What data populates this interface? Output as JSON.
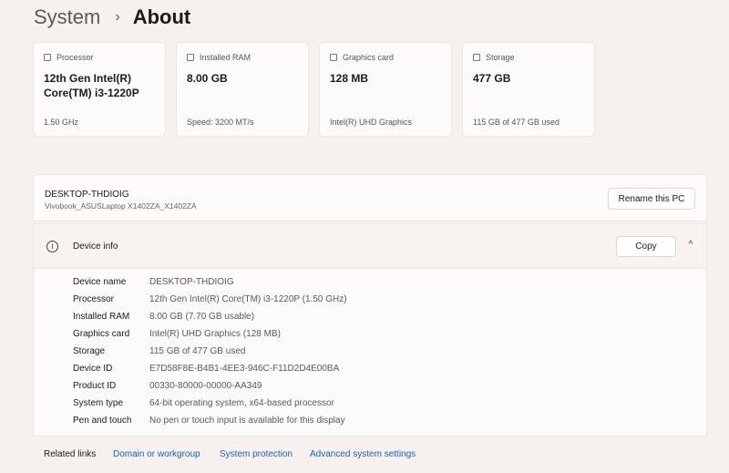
{
  "breadcrumb": {
    "parent": "System",
    "separator": "›",
    "current": "About"
  },
  "cards": [
    {
      "icon": "processor-icon",
      "label": "Processor",
      "value": "12th Gen Intel(R) Core(TM) i3-1220P",
      "foot": "1.50 GHz"
    },
    {
      "icon": "ram-icon",
      "label": "Installed RAM",
      "value": "8.00 GB",
      "foot": "Speed: 3200 MT/s"
    },
    {
      "icon": "graphics-card-icon",
      "label": "Graphics card",
      "value": "128 MB",
      "foot": "Intel(R) UHD Graphics"
    },
    {
      "icon": "storage-icon",
      "label": "Storage",
      "value": "477 GB",
      "foot": "115 GB of 477 GB used"
    }
  ],
  "pc": {
    "name": "DESKTOP-THDIOIG",
    "model": "Vivobook_ASUSLaptop X1402ZA_X1402ZA",
    "rename_label": "Rename this PC"
  },
  "device_info": {
    "title": "Device info",
    "info_icon_glyph": "i",
    "copy_label": "Copy",
    "chevron_glyph": "^",
    "rows": [
      {
        "label": "Device name",
        "value": "DESKTOP-THDIOIG"
      },
      {
        "label": "Processor",
        "value": "12th Gen Intel(R) Core(TM) i3-1220P (1.50 GHz)"
      },
      {
        "label": "Installed RAM",
        "value": "8.00 GB (7.70 GB usable)"
      },
      {
        "label": "Graphics card",
        "value": "Intel(R) UHD Graphics (128 MB)"
      },
      {
        "label": "Storage",
        "value": "115 GB of 477 GB used"
      },
      {
        "label": "Device ID",
        "value": "E7D58F8E-B4B1-4EE3-946C-F11D2D4E00BA"
      },
      {
        "label": "Product ID",
        "value": "00330-80000-00000-AA349"
      },
      {
        "label": "System type",
        "value": "64-bit operating system, x64-based processor"
      },
      {
        "label": "Pen and touch",
        "value": "No pen or touch input is available for this display"
      }
    ]
  },
  "related": {
    "label": "Related links",
    "links": [
      "Domain or workgroup",
      "System protection",
      "Advanced system settings"
    ]
  },
  "colors": {
    "background": "#f6f0ee",
    "card": "#fdfbfa",
    "link": "#1f5fb8"
  }
}
